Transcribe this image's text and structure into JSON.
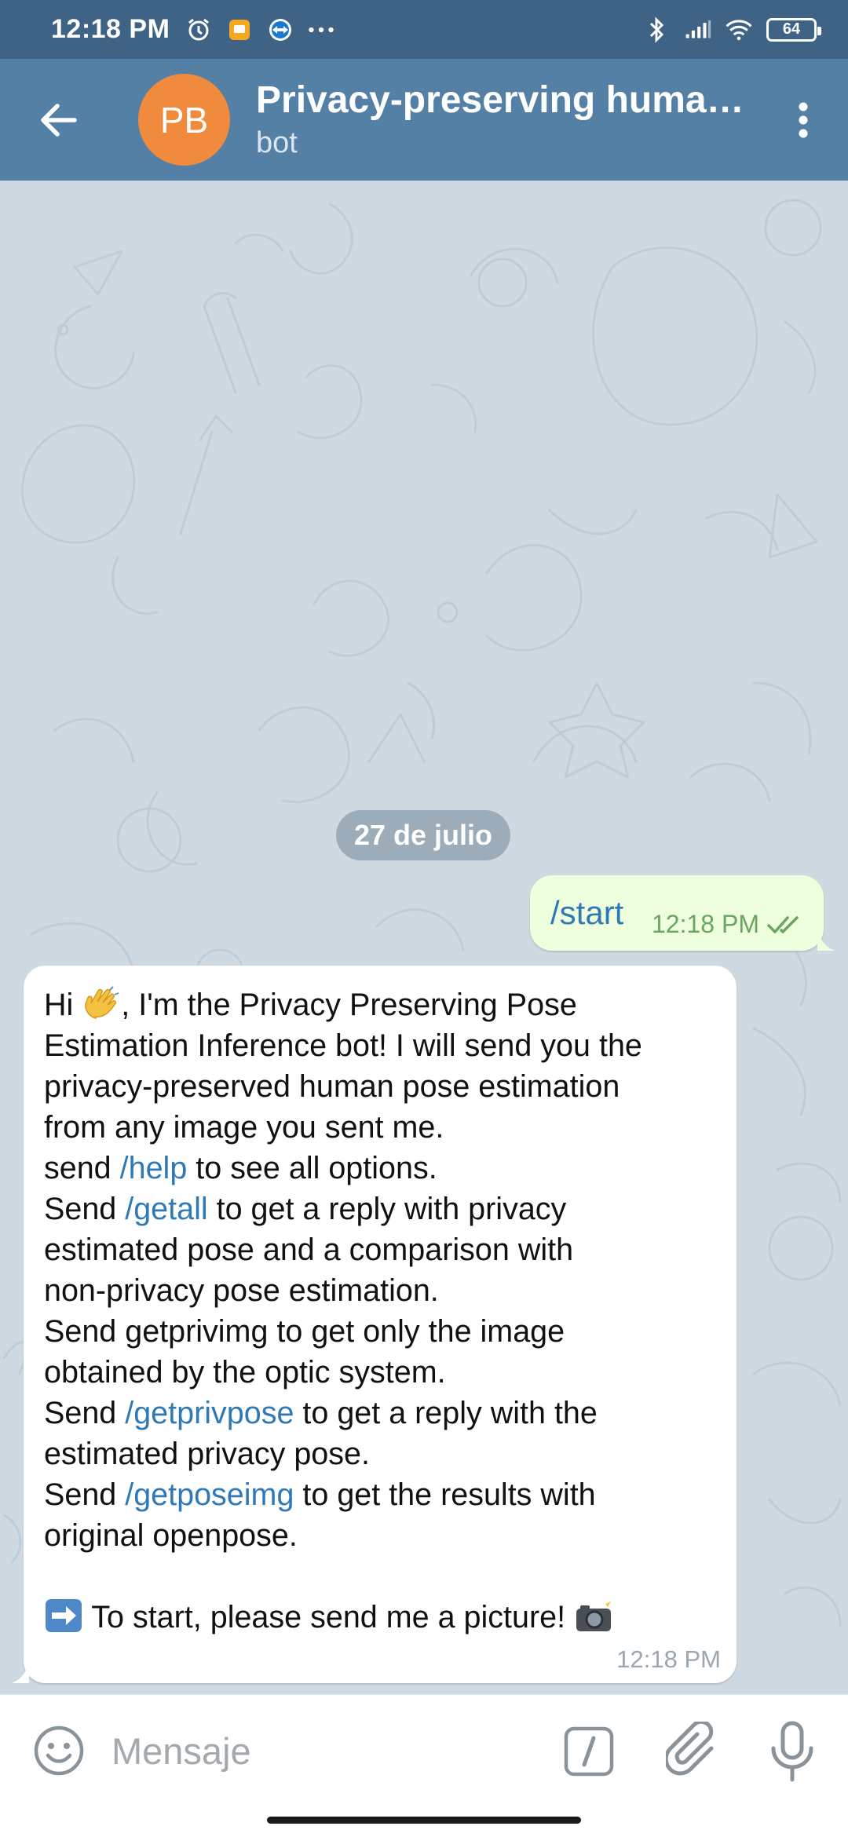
{
  "status_bar": {
    "time": "12:18 PM",
    "battery": "64",
    "icons_left": [
      "alarm-icon",
      "notes-app-icon",
      "teamviewer-icon",
      "more-dots-icon"
    ],
    "icons_right": [
      "bluetooth-icon",
      "signal-icon",
      "wifi-icon",
      "battery-icon"
    ]
  },
  "header": {
    "avatar_initials": "PB",
    "avatar_color": "#f08a3c",
    "title": "Privacy-preserving human…",
    "subtitle": "bot"
  },
  "chat": {
    "date_label": "27 de julio",
    "outgoing": {
      "text": "/start",
      "time": "12:18 PM",
      "status": "read-double-check"
    },
    "incoming": {
      "lines": [
        {
          "t1": "Hi ",
          "emoji": "waving-hand-emoji",
          "t2": ", I'm the Privacy Preserving Pose"
        },
        {
          "t": "Estimation Inference bot! I will send you the"
        },
        {
          "t": "privacy-preserved human pose estimation"
        },
        {
          "t": "from any image you sent me."
        },
        {
          "pre": " send ",
          "cmd": "/help",
          "post": " to see all options."
        },
        {
          "pre": " Send ",
          "cmd": "/getall",
          "post": " to get a reply with privacy"
        },
        {
          "t": "estimated pose and a comparison with"
        },
        {
          "t": "non-privacy pose estimation."
        },
        {
          "t": " Send getprivimg to get only the image"
        },
        {
          "t": "obtained by the optic system."
        },
        {
          "pre": " Send ",
          "cmd": "/getprivpose",
          "post": " to get a reply with the"
        },
        {
          "t": "estimated privacy pose."
        },
        {
          "pre": " Send ",
          "cmd": "/getposeimg",
          "post": " to get the results with"
        },
        {
          "t": "original openpose."
        },
        {
          "t": ""
        },
        {
          "t1": "",
          "emoji": "right-arrow-emoji",
          "t2": " To start, please send me a picture! ",
          "emoji2": "camera-flash-emoji"
        }
      ],
      "time": "12:18 PM"
    }
  },
  "input": {
    "placeholder": "Mensaje"
  },
  "colors": {
    "status_bar": "#3f6384",
    "header": "#5580a6",
    "chat_bg": "#cfd9e2",
    "outgoing_bubble": "#effedd",
    "command_link": "#2f79b6",
    "read_check": "#6aa65f"
  }
}
